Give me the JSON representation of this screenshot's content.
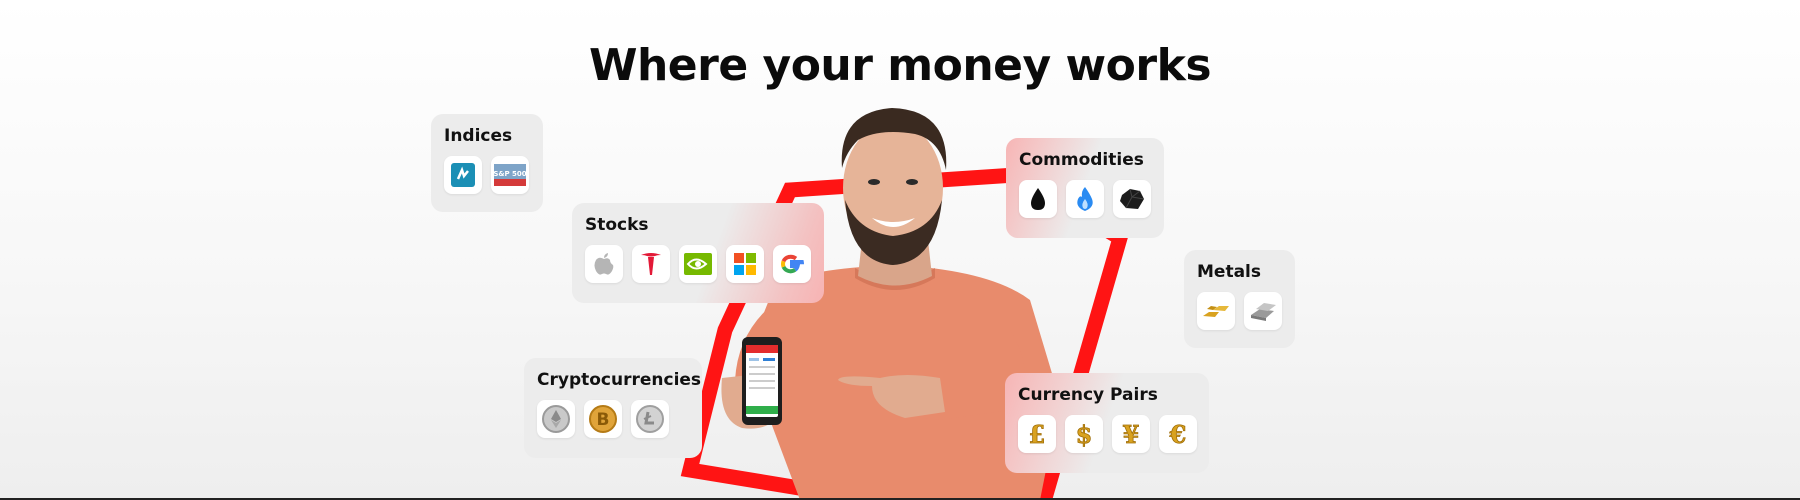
{
  "headline": "Where your money works",
  "categories": {
    "indices": {
      "title": "Indices",
      "icons": [
        "nasdaq-icon",
        "sp500-icon"
      ]
    },
    "stocks": {
      "title": "Stocks",
      "icons": [
        "apple-icon",
        "tesla-icon",
        "nvidia-icon",
        "microsoft-icon",
        "google-icon"
      ]
    },
    "commodities": {
      "title": "Commodities",
      "icons": [
        "oil-drop-icon",
        "gas-flame-icon",
        "coal-icon"
      ]
    },
    "metals": {
      "title": "Metals",
      "icons": [
        "gold-bars-icon",
        "silver-bars-icon"
      ]
    },
    "crypto": {
      "title": "Cryptocurrencies",
      "icons": [
        "ethereum-coin-icon",
        "bitcoin-coin-icon",
        "litecoin-coin-icon"
      ]
    },
    "currency": {
      "title": "Currency Pairs",
      "icons": [
        "pound-icon",
        "dollar-icon",
        "yen-icon",
        "euro-icon"
      ]
    }
  },
  "sp500_icon_text": "S&P 500",
  "colors": {
    "accent": "#ff1414",
    "card_bg": "#ececec",
    "gold": "#d9a21f",
    "shirt": "#e88b6c"
  }
}
